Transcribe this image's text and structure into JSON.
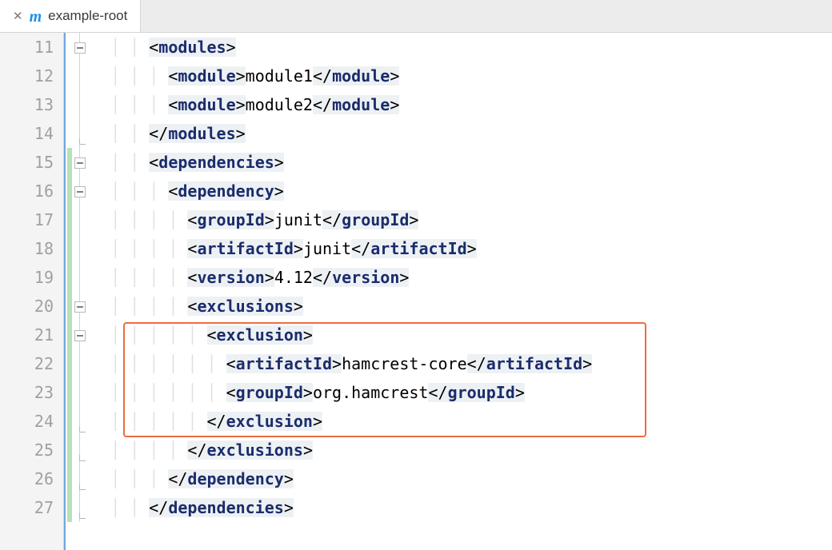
{
  "tab": {
    "title": "example-root"
  },
  "lineNumbers": [
    "11",
    "12",
    "13",
    "14",
    "15",
    "16",
    "17",
    "18",
    "19",
    "20",
    "21",
    "22",
    "23",
    "24",
    "25",
    "26",
    "27"
  ],
  "code": [
    {
      "indent": 1,
      "parts": [
        {
          "t": "open",
          "name": "modules"
        }
      ]
    },
    {
      "indent": 2,
      "parts": [
        {
          "t": "open",
          "name": "module"
        },
        {
          "t": "text",
          "v": "module1"
        },
        {
          "t": "close",
          "name": "module"
        }
      ]
    },
    {
      "indent": 2,
      "parts": [
        {
          "t": "open",
          "name": "module"
        },
        {
          "t": "text",
          "v": "module2"
        },
        {
          "t": "close",
          "name": "module"
        }
      ]
    },
    {
      "indent": 1,
      "parts": [
        {
          "t": "close",
          "name": "modules"
        }
      ]
    },
    {
      "indent": 1,
      "parts": [
        {
          "t": "open",
          "name": "dependencies"
        }
      ]
    },
    {
      "indent": 2,
      "parts": [
        {
          "t": "open",
          "name": "dependency"
        }
      ]
    },
    {
      "indent": 3,
      "parts": [
        {
          "t": "open",
          "name": "groupId"
        },
        {
          "t": "text",
          "v": "junit"
        },
        {
          "t": "close",
          "name": "groupId"
        }
      ]
    },
    {
      "indent": 3,
      "parts": [
        {
          "t": "open",
          "name": "artifactId"
        },
        {
          "t": "text",
          "v": "junit"
        },
        {
          "t": "close",
          "name": "artifactId"
        }
      ]
    },
    {
      "indent": 3,
      "parts": [
        {
          "t": "open",
          "name": "version"
        },
        {
          "t": "text",
          "v": "4.12"
        },
        {
          "t": "close",
          "name": "version"
        }
      ]
    },
    {
      "indent": 3,
      "parts": [
        {
          "t": "open",
          "name": "exclusions"
        }
      ]
    },
    {
      "indent": 4,
      "parts": [
        {
          "t": "open",
          "name": "exclusion"
        }
      ]
    },
    {
      "indent": 5,
      "parts": [
        {
          "t": "open",
          "name": "artifactId"
        },
        {
          "t": "text",
          "v": "hamcrest-core"
        },
        {
          "t": "close",
          "name": "artifactId"
        }
      ]
    },
    {
      "indent": 5,
      "parts": [
        {
          "t": "open",
          "name": "groupId"
        },
        {
          "t": "text",
          "v": "org.hamcrest"
        },
        {
          "t": "close",
          "name": "groupId"
        }
      ]
    },
    {
      "indent": 4,
      "parts": [
        {
          "t": "close",
          "name": "exclusion"
        }
      ]
    },
    {
      "indent": 3,
      "parts": [
        {
          "t": "close",
          "name": "exclusions"
        }
      ]
    },
    {
      "indent": 2,
      "parts": [
        {
          "t": "close",
          "name": "dependency"
        }
      ]
    },
    {
      "indent": 1,
      "parts": [
        {
          "t": "close",
          "name": "dependencies"
        }
      ]
    }
  ],
  "annotation": {
    "fromLine": 21,
    "toLine": 24
  },
  "gutterMarks": {
    "foldMinus": [
      11,
      15,
      16,
      20,
      21
    ],
    "foldEnd": [
      14,
      24,
      25,
      26,
      27
    ],
    "vcsGreen": {
      "from": 15,
      "to": 27
    }
  }
}
